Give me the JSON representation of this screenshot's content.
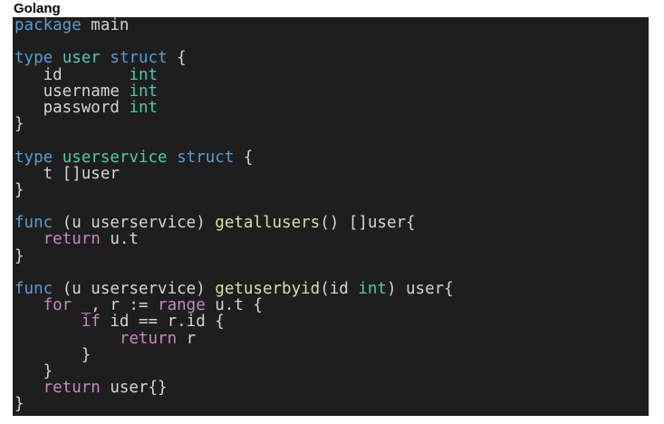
{
  "header": {
    "title": "Golang"
  },
  "code": {
    "lines": [
      [
        {
          "t": "package",
          "c": "kw"
        },
        {
          "t": " main",
          "c": "pl"
        }
      ],
      [],
      [
        {
          "t": "type",
          "c": "kw"
        },
        {
          "t": " ",
          "c": "pl"
        },
        {
          "t": "user",
          "c": "ty"
        },
        {
          "t": " ",
          "c": "pl"
        },
        {
          "t": "struct",
          "c": "kw"
        },
        {
          "t": " {",
          "c": "pl"
        }
      ],
      [
        {
          "t": "   id       ",
          "c": "pl"
        },
        {
          "t": "int",
          "c": "ty"
        }
      ],
      [
        {
          "t": "   username ",
          "c": "pl"
        },
        {
          "t": "int",
          "c": "ty"
        }
      ],
      [
        {
          "t": "   password ",
          "c": "pl"
        },
        {
          "t": "int",
          "c": "ty"
        }
      ],
      [
        {
          "t": "}",
          "c": "pl"
        }
      ],
      [],
      [
        {
          "t": "type",
          "c": "kw"
        },
        {
          "t": " ",
          "c": "pl"
        },
        {
          "t": "userservice",
          "c": "ty"
        },
        {
          "t": " ",
          "c": "pl"
        },
        {
          "t": "struct",
          "c": "kw"
        },
        {
          "t": " {",
          "c": "pl"
        }
      ],
      [
        {
          "t": "   t []user",
          "c": "pl"
        }
      ],
      [
        {
          "t": "}",
          "c": "pl"
        }
      ],
      [],
      [
        {
          "t": "func",
          "c": "kw"
        },
        {
          "t": " (u userservice) ",
          "c": "pl"
        },
        {
          "t": "getallusers",
          "c": "fn"
        },
        {
          "t": "() []user{",
          "c": "pl"
        }
      ],
      [
        {
          "t": "   ",
          "c": "pl"
        },
        {
          "t": "return",
          "c": "ctrl"
        },
        {
          "t": " u.t",
          "c": "pl"
        }
      ],
      [
        {
          "t": "}",
          "c": "pl"
        }
      ],
      [],
      [
        {
          "t": "func",
          "c": "kw"
        },
        {
          "t": " (u userservice) ",
          "c": "pl"
        },
        {
          "t": "getuserbyid",
          "c": "fn"
        },
        {
          "t": "(id ",
          "c": "pl"
        },
        {
          "t": "int",
          "c": "ty"
        },
        {
          "t": ") user{",
          "c": "pl"
        }
      ],
      [
        {
          "t": "   ",
          "c": "pl"
        },
        {
          "t": "for",
          "c": "ctrl"
        },
        {
          "t": " _, r := ",
          "c": "pl"
        },
        {
          "t": "range",
          "c": "ctrl"
        },
        {
          "t": " u.t {",
          "c": "pl"
        }
      ],
      [
        {
          "t": "       ",
          "c": "pl"
        },
        {
          "t": "if",
          "c": "ctrl"
        },
        {
          "t": " id == r.id {",
          "c": "pl"
        }
      ],
      [
        {
          "t": "           ",
          "c": "pl"
        },
        {
          "t": "return",
          "c": "ctrl"
        },
        {
          "t": " r",
          "c": "pl"
        }
      ],
      [
        {
          "t": "       }",
          "c": "pl"
        }
      ],
      [
        {
          "t": "   }",
          "c": "pl"
        }
      ],
      [
        {
          "t": "   ",
          "c": "pl"
        },
        {
          "t": "return",
          "c": "ctrl"
        },
        {
          "t": " user{}",
          "c": "pl"
        }
      ],
      [
        {
          "t": "}",
          "c": "pl"
        }
      ]
    ]
  },
  "theme": {
    "background": "#1e1e1e",
    "keyword": "#569cd6",
    "control": "#c586c0",
    "type": "#4ec9b0",
    "function": "#dcdcaa",
    "text": "#d4d4d4"
  }
}
